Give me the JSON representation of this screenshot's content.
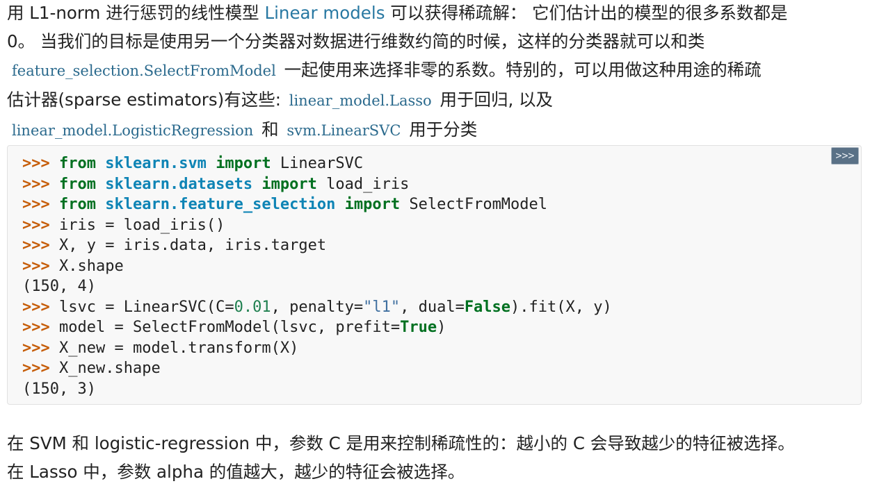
{
  "para1": {
    "t1": "用 L1-norm 进行惩罚的线性模型 ",
    "link1": "Linear models",
    "t2": " 可以获得稀疏解： 它们估计出的模型的很多系数都是",
    "t3": "0。 当我们的目标是使用另一个分类器对数据进行维数约简的时候，这样的分类器就可以和类",
    "ref1": "feature_selection.SelectFromModel",
    "t4": "一起使用来选择非零的系数。特别的，可以用做这种用途的稀疏",
    "t5": "估计器(sparse estimators)有这些: ",
    "ref2": "linear_model.Lasso",
    "t6": "用于回归, 以及",
    "ref3": "linear_model.LogisticRegression",
    "t7": "和",
    "ref4": "svm.LinearSVC",
    "t8": "用于分类"
  },
  "code": {
    "copy_label": ">>>",
    "prompt": ">>>",
    "lines": [
      {
        "kw1": "from",
        "mod": "sklearn.svm",
        "kw2": "import",
        "name": "LinearSVC"
      },
      {
        "kw1": "from",
        "mod": "sklearn.datasets",
        "kw2": "import",
        "name": "load_iris"
      },
      {
        "kw1": "from",
        "mod": "sklearn.feature_selection",
        "kw2": "import",
        "name": "SelectFromModel"
      }
    ],
    "l4": "iris = load_iris()",
    "l5": "X, y = iris.data, iris.target",
    "l6": "X.shape",
    "o1": "(150, 4)",
    "l8a": "lsvc = LinearSVC(C=",
    "l8num": "0.01",
    "l8b": ", penalty=",
    "l8str": "\"l1\"",
    "l8c": ", dual=",
    "l8kw": "False",
    "l8d": ").fit(X, y)",
    "l9a": "model = SelectFromModel(lsvc, prefit=",
    "l9kw": "True",
    "l9b": ")",
    "l10": "X_new = model.transform(X)",
    "l11": "X_new.shape",
    "o2": "(150, 3)"
  },
  "para2": {
    "line1": "在 SVM 和 logistic-regression 中，参数 C 是用来控制稀疏性的：越小的 C 会导致越少的特征被选择。",
    "line2": "在 Lasso 中，参数 alpha 的值越大，越少的特征会被选择。"
  }
}
